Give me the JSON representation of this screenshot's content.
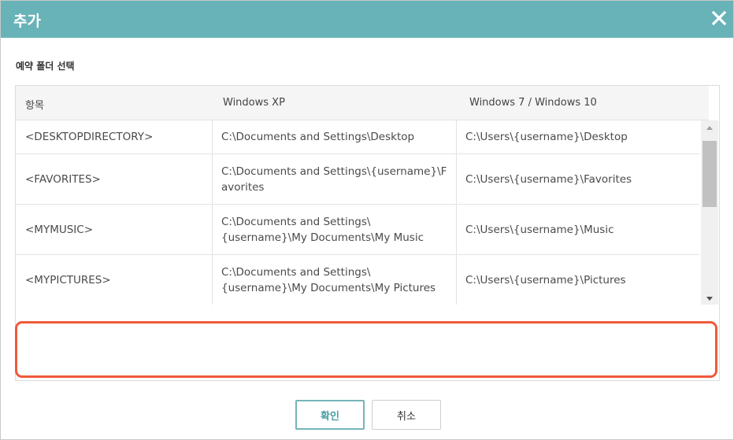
{
  "dialog": {
    "title": "추가",
    "close_icon": "close-icon",
    "section_label": "예약 폴더 선택"
  },
  "table": {
    "headers": [
      "항목",
      "Windows XP",
      "Windows 7 / Windows 10"
    ],
    "rows": [
      {
        "item": "<DESKTOPDIRECTORY>",
        "xp": "C:\\Documents and Settings\\Desktop",
        "win7": "C:\\Users\\{username}\\Desktop"
      },
      {
        "item": "<FAVORITES>",
        "xp": "C:\\Documents and Settings\\{username}\\Favorites",
        "win7": "C:\\Users\\{username}\\Favorites"
      },
      {
        "item": "<MYMUSIC>",
        "xp": "C:\\Documents and Settings\\{username}\\My Documents\\My Music",
        "win7": "C:\\Users\\{username}\\Music"
      },
      {
        "item": "<MYPICTURES>",
        "xp": "C:\\Documents and Settings\\{username}\\My Documents\\My Pictures",
        "win7": "C:\\Users\\{username}\\Pictures"
      }
    ]
  },
  "buttons": {
    "ok": "확인",
    "cancel": "취소"
  },
  "colors": {
    "titlebar": "#68b3b8",
    "highlight": "#f05a3a",
    "ok_border": "#74b5b8"
  }
}
